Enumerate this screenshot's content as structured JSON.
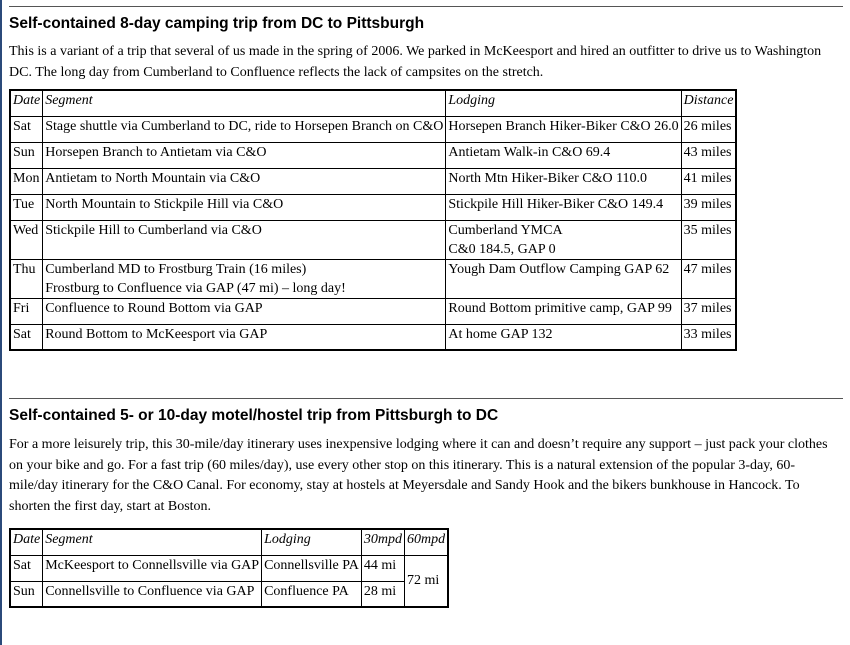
{
  "sections": [
    {
      "title": "Self-contained 8-day camping trip from DC to Pittsburgh",
      "intro": "This is a variant of a trip that several of us made in the spring of 2006. We parked in McKeesport and hired an outfitter to drive us to Washington DC. The long day from Cumberland to Confluence reflects the lack of campsites on the stretch.",
      "headers": [
        "Date",
        "Segment",
        "Lodging",
        "Distance"
      ],
      "rows": [
        {
          "date": "Sat",
          "segment": [
            "Stage shuttle via Cumberland to DC, ride to Horsepen Branch on C&O"
          ],
          "lodging": [
            "Horsepen Branch Hiker-Biker C&O 26.0"
          ],
          "distance": "26 miles"
        },
        {
          "date": "Sun",
          "segment": [
            "Horsepen Branch to Antietam via C&O"
          ],
          "lodging": [
            "Antietam Walk-in C&O 69.4"
          ],
          "distance": "43 miles"
        },
        {
          "date": "Mon",
          "segment": [
            "Antietam to North Mountain via C&O"
          ],
          "lodging": [
            "North Mtn Hiker-Biker C&O 110.0"
          ],
          "distance": "41 miles"
        },
        {
          "date": "Tue",
          "segment": [
            "North Mountain to Stickpile Hill via C&O"
          ],
          "lodging": [
            "Stickpile Hill Hiker-Biker C&O 149.4"
          ],
          "distance": "39 miles"
        },
        {
          "date": "Wed",
          "segment": [
            "Stickpile Hill to Cumberland via C&O"
          ],
          "lodging": [
            "Cumberland YMCA",
            "C&0 184.5, GAP 0"
          ],
          "distance": "35 miles"
        },
        {
          "date": "Thu",
          "segment": [
            "Cumberland MD to Frostburg Train (16 miles)",
            "Frostburg to Confluence via GAP (47 mi) – long day!"
          ],
          "lodging": [
            "Yough Dam Outflow Camping GAP 62"
          ],
          "distance": "47 miles"
        },
        {
          "date": "Fri",
          "segment": [
            "Confluence to Round Bottom via GAP"
          ],
          "lodging": [
            "Round Bottom primitive camp, GAP 99"
          ],
          "distance": "37 miles"
        },
        {
          "date": "Sat",
          "segment": [
            "Round Bottom to McKeesport via GAP"
          ],
          "lodging": [
            "At home GAP 132"
          ],
          "distance": "33 miles"
        }
      ]
    },
    {
      "title": "Self-contained 5- or 10-day motel/hostel trip from Pittsburgh to DC",
      "intro": "For a more leisurely trip, this 30-mile/day itinerary uses inexpensive lodging where it can and doesn’t require any support – just pack your clothes on your bike and go. For a fast trip (60 miles/day), use every other stop on this itinerary. This is a natural extension of the popular 3-day, 60-mile/day itinerary for the C&O Canal. For economy, stay at hostels at Meyersdale and Sandy Hook and the bikers bunkhouse in Hancock. To shorten the first day, start at Boston.",
      "headers": [
        "Date",
        "Segment",
        "Lodging",
        "30mpd",
        "60mpd"
      ],
      "rows": [
        {
          "date": "Sat",
          "segment": "McKeesport to Connellsville via GAP",
          "lodging": "Connellsville PA",
          "mpd30": "44 mi"
        },
        {
          "date": "Sun",
          "segment": "Connellsville to Confluence via GAP",
          "lodging": "Confluence PA",
          "mpd30": "28 mi"
        }
      ],
      "mpd60_merged": "72 mi"
    }
  ]
}
